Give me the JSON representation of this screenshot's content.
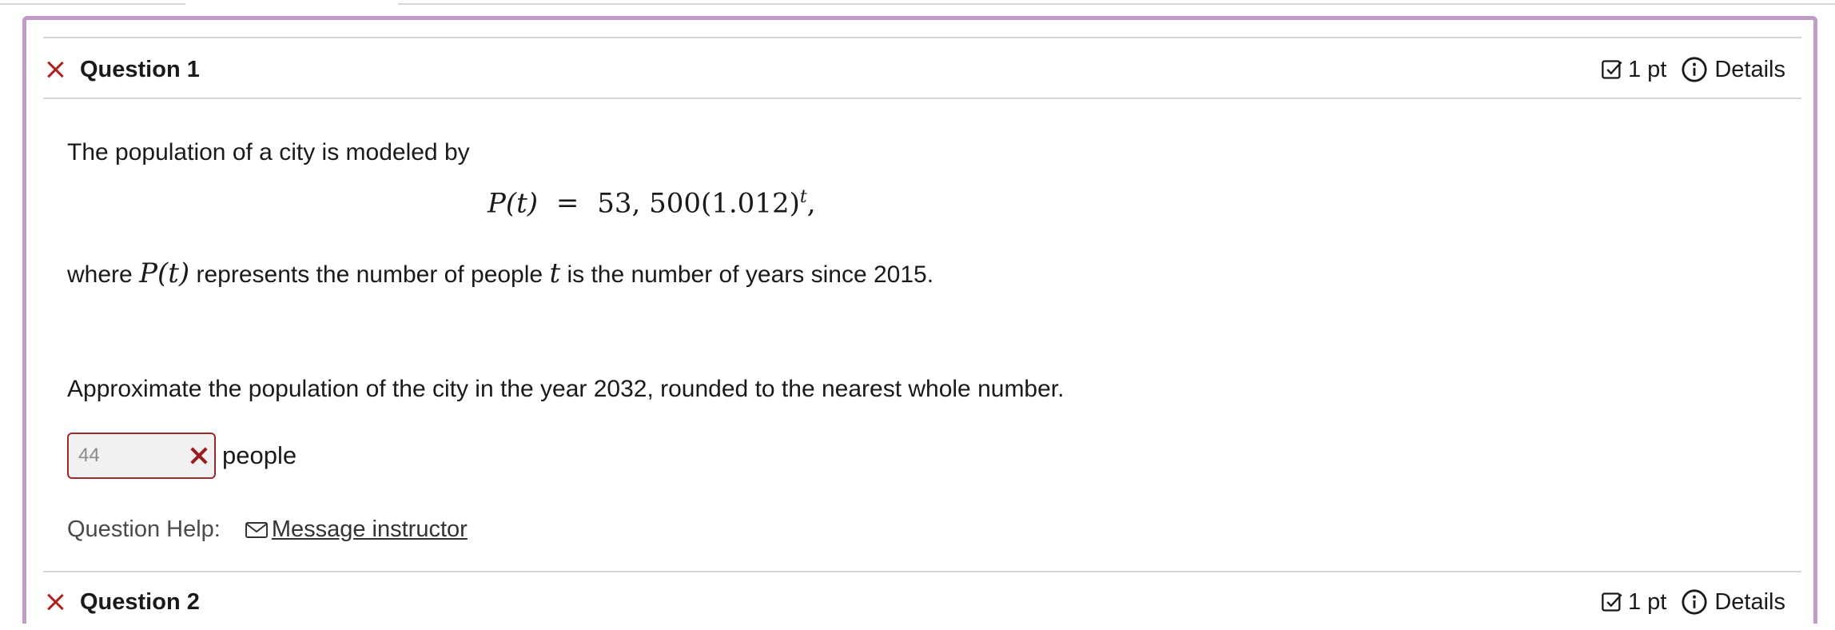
{
  "question1": {
    "title": "Question 1",
    "points": "1 pt",
    "details_label": "Details",
    "intro": "The population of a city is modeled by",
    "formula": {
      "lhs": "P(t)",
      "equals": "=",
      "rhs_base": "53, 500(1.012)",
      "exponent": "t",
      "trailing": ","
    },
    "where_prefix": "where",
    "where_symbol_p": "P(t)",
    "where_mid": "represents the number of people",
    "where_symbol_t": "t",
    "where_suffix": "is the number of years since 2015.",
    "prompt": "Approximate the population of the city in the year 2032, rounded to the nearest whole number.",
    "answer_value": "44",
    "answer_units": "people",
    "help_label": "Question Help:",
    "help_link": "Message instructor"
  },
  "question2": {
    "title": "Question 2",
    "points": "1 pt",
    "details_label": "Details"
  },
  "colors": {
    "frame_border": "#c39bc8",
    "incorrect": "#b02020",
    "input_bg": "#f1f1f1"
  },
  "icons": {
    "incorrect": "x-icon",
    "points": "checkbox-icon",
    "details": "info-icon",
    "message": "mail-icon",
    "answer_wrong": "wrong-x-icon"
  }
}
